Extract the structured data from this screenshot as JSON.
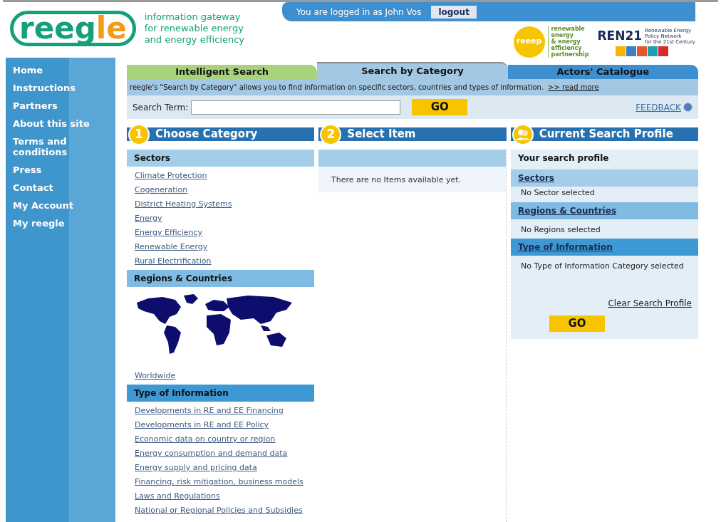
{
  "logo": {
    "main": "reeg",
    "accent": "le"
  },
  "tagline": [
    "information gateway",
    "for renewable energy",
    "and energy efficiency"
  ],
  "login_bar": {
    "text": "You are logged in as John Vos",
    "button": "logout"
  },
  "partners": [
    {
      "kind": "reeep",
      "mark": "reeep",
      "caption": [
        "renewable",
        "energy",
        "& energy",
        "efficiency",
        "partnership"
      ]
    },
    {
      "kind": "ren21",
      "mark": "REN21",
      "caption": [
        "Renewable Energy",
        "Policy Network",
        "for the 21st Century"
      ]
    }
  ],
  "sidebar": {
    "items": [
      {
        "label": "Home"
      },
      {
        "label": "Instructions"
      },
      {
        "label": "Partners"
      },
      {
        "label": "About this site"
      },
      {
        "label": "Terms and conditions"
      },
      {
        "label": "Press"
      },
      {
        "label": "Contact"
      },
      {
        "label": "My Account"
      },
      {
        "label": "My reegle"
      }
    ]
  },
  "tabs": [
    {
      "label": "Intelligent Search",
      "selected": false,
      "color": "#a9d27c"
    },
    {
      "label": "Search by Category",
      "selected": true,
      "color": "#a3c8e3"
    },
    {
      "label": "Actors' Catalogue",
      "selected": false,
      "color": "#3d8fcf"
    }
  ],
  "description": {
    "text": "reegle's \"Search by Category\" allows you to find information on specific sectors, countries and types of information.",
    "link": ">> read more"
  },
  "search": {
    "label": "Search Term:",
    "button": "GO",
    "feedback": "FEEDBACK"
  },
  "steps": [
    {
      "kind": "number",
      "badge": "1",
      "title": "Choose Category"
    },
    {
      "kind": "number",
      "badge": "2",
      "title": "Select Item"
    },
    {
      "kind": "profile",
      "title": "Current Search Profile"
    }
  ],
  "categories": [
    {
      "title": "Sectors",
      "kind": "links",
      "links": [
        "Climate Protection",
        "Cogeneration",
        "District Heating Systems",
        "Energy",
        "Energy Efficiency",
        "Renewable Energy",
        "Rural Electrification"
      ]
    },
    {
      "title": "Regions & Countries",
      "kind": "map",
      "links": [
        "Worldwide"
      ]
    },
    {
      "title": "Type of Information",
      "kind": "links",
      "links": [
        "Developments in RE and EE Financing",
        "Developments in RE and EE Policy",
        "Economic data on country or region",
        "Energy consumption and demand data",
        "Energy supply and pricing data",
        "Financing, risk mitigation, business models",
        "Laws and Regulations",
        "National or Regional Policies and Subsidies"
      ]
    }
  ],
  "items": {
    "empty_text": "There are no Items available yet."
  },
  "profile": {
    "title": "Your search profile",
    "groups": [
      {
        "title": "Sectors",
        "value": "No Sector selected"
      },
      {
        "title": "Regions & Countries",
        "value": "No Regions selected"
      },
      {
        "title": "Type of Information",
        "value": "No Type of Information Category selected"
      }
    ],
    "clear": "Clear Search Profile",
    "button": "GO"
  }
}
